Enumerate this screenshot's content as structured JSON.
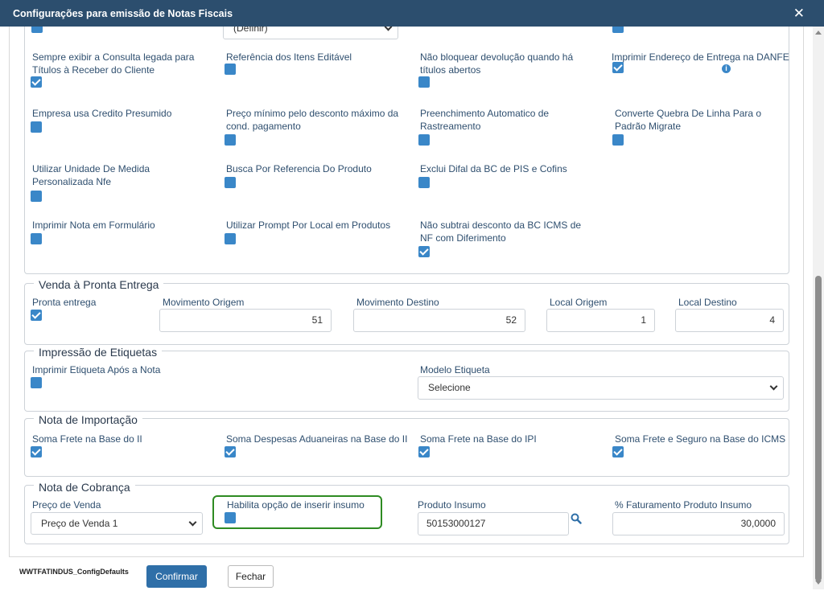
{
  "dialog": {
    "title": "Configurações para emissão de Notas Fiscais"
  },
  "top": {
    "select_value": "(Definir)",
    "rows": [
      [
        "Sempre exibir a Consulta legada para Títulos à Receber do Cliente",
        "Referência dos Itens Editável",
        "Não bloquear devolução quando há títulos abertos",
        "Imprimir Endereço de Entrega na DANFE"
      ],
      [
        "Empresa usa Credito Presumido",
        "Preço mínimo pelo desconto máximo da cond. pagamento",
        "Preenchimento Automatico de Rastreamento",
        "Converte Quebra De Linha Para o Padrão Migrate"
      ],
      [
        "Utilizar Unidade De Medida Personalizada Nfe",
        "Busca Por Referencia Do Produto",
        "Exclui Difal da BC de PIS e Cofins"
      ],
      [
        "Imprimir Nota em Formulário",
        "Utilizar Prompt Por Local em Produtos",
        "Não subtrai desconto da BC ICMS de NF com Diferimento"
      ]
    ],
    "info_glyph": "i"
  },
  "pronta": {
    "legend": "Venda à Pronta Entrega",
    "checkbox_label": "Pronta entrega",
    "mov_origem_label": "Movimento Origem",
    "mov_origem_value": "51",
    "mov_destino_label": "Movimento Destino",
    "mov_destino_value": "52",
    "local_origem_label": "Local Origem",
    "local_origem_value": "1",
    "local_destino_label": "Local Destino",
    "local_destino_value": "4"
  },
  "etiquetas": {
    "legend": "Impressão de Etiquetas",
    "checkbox_label": "Imprimir Etiqueta Após a Nota",
    "modelo_label": "Modelo Etiqueta",
    "modelo_value": "Selecione"
  },
  "importacao": {
    "legend": "Nota de Importação",
    "items": [
      "Soma Frete na Base do II",
      "Soma Despesas Aduaneiras na Base do II",
      "Soma Frete na Base do IPI",
      "Soma Frete e Seguro na Base do ICMS"
    ]
  },
  "cobranca": {
    "legend": "Nota de Cobrança",
    "preco_label": "Preço de Venda",
    "preco_value": "Preço de Venda 1",
    "insumo_check_label": "Habilita opção de inserir insumo",
    "produto_label": "Produto Insumo",
    "produto_value": "50153000127",
    "fat_label": "% Faturamento Produto Insumo",
    "fat_value": "30,0000"
  },
  "footer": {
    "program_name": "WWTFATINDUS_ConfigDefaults",
    "confirm_label": "Confirmar",
    "close_label": "Fechar"
  },
  "colors": {
    "header": "#2c4e6e",
    "checkbox": "#3a87c8",
    "primary_button": "#2f6fa8",
    "highlight": "#2e8b22"
  },
  "icons": {
    "close": "close-icon",
    "info": "info-icon",
    "search": "search-icon"
  }
}
